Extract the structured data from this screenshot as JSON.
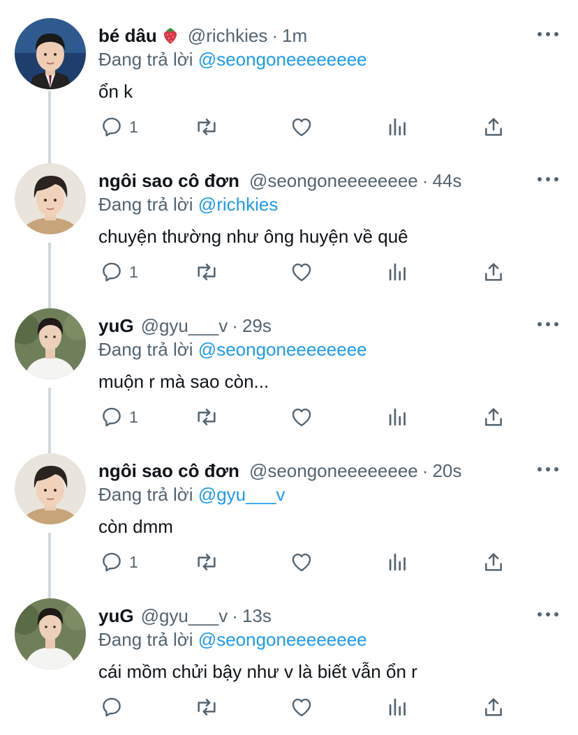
{
  "colors": {
    "text_primary": "#0f1419",
    "text_secondary": "#536471",
    "link": "#1d9bf0",
    "thread_line": "#cfd9de",
    "background": "#ffffff"
  },
  "replying_prefix": "Đang trả lời",
  "tweets": [
    {
      "name": "bé dâu",
      "emoji": "strawberry-emoji",
      "handle": "@richkies",
      "separator": "·",
      "time": "1m",
      "replying_to": "@seongoneeeeeeee",
      "text": "ổn k",
      "reply_count": "1",
      "avatar": "avatar-boy-school-uniform"
    },
    {
      "name": "ngôi sao cô đơn",
      "handle": "@seongoneeeeeeee",
      "separator": "·",
      "time": "44s",
      "replying_to": "@richkies",
      "text": "chuyện thường như ông huyện về quê",
      "reply_count": "1",
      "avatar": "avatar-young-man-brown-sweater"
    },
    {
      "name": "yuG",
      "handle": "@gyu___v",
      "separator": "·",
      "time": "29s",
      "replying_to": "@seongoneeeeeeee",
      "text": "muộn r mà sao còn...",
      "reply_count": "1",
      "avatar": "avatar-young-man-white-shirt"
    },
    {
      "name": "ngôi sao cô đơn",
      "handle": "@seongoneeeeeeee",
      "separator": "·",
      "time": "20s",
      "replying_to": "@gyu___v",
      "text": "còn dmm",
      "reply_count": "1",
      "avatar": "avatar-young-man-brown-sweater"
    },
    {
      "name": "yuG",
      "handle": "@gyu___v",
      "separator": "·",
      "time": "13s",
      "replying_to": "@seongoneeeeeeee",
      "text": "cái mồm chửi bậy như v là biết vẫn ổn r",
      "reply_count": "",
      "avatar": "avatar-young-man-white-shirt"
    }
  ]
}
